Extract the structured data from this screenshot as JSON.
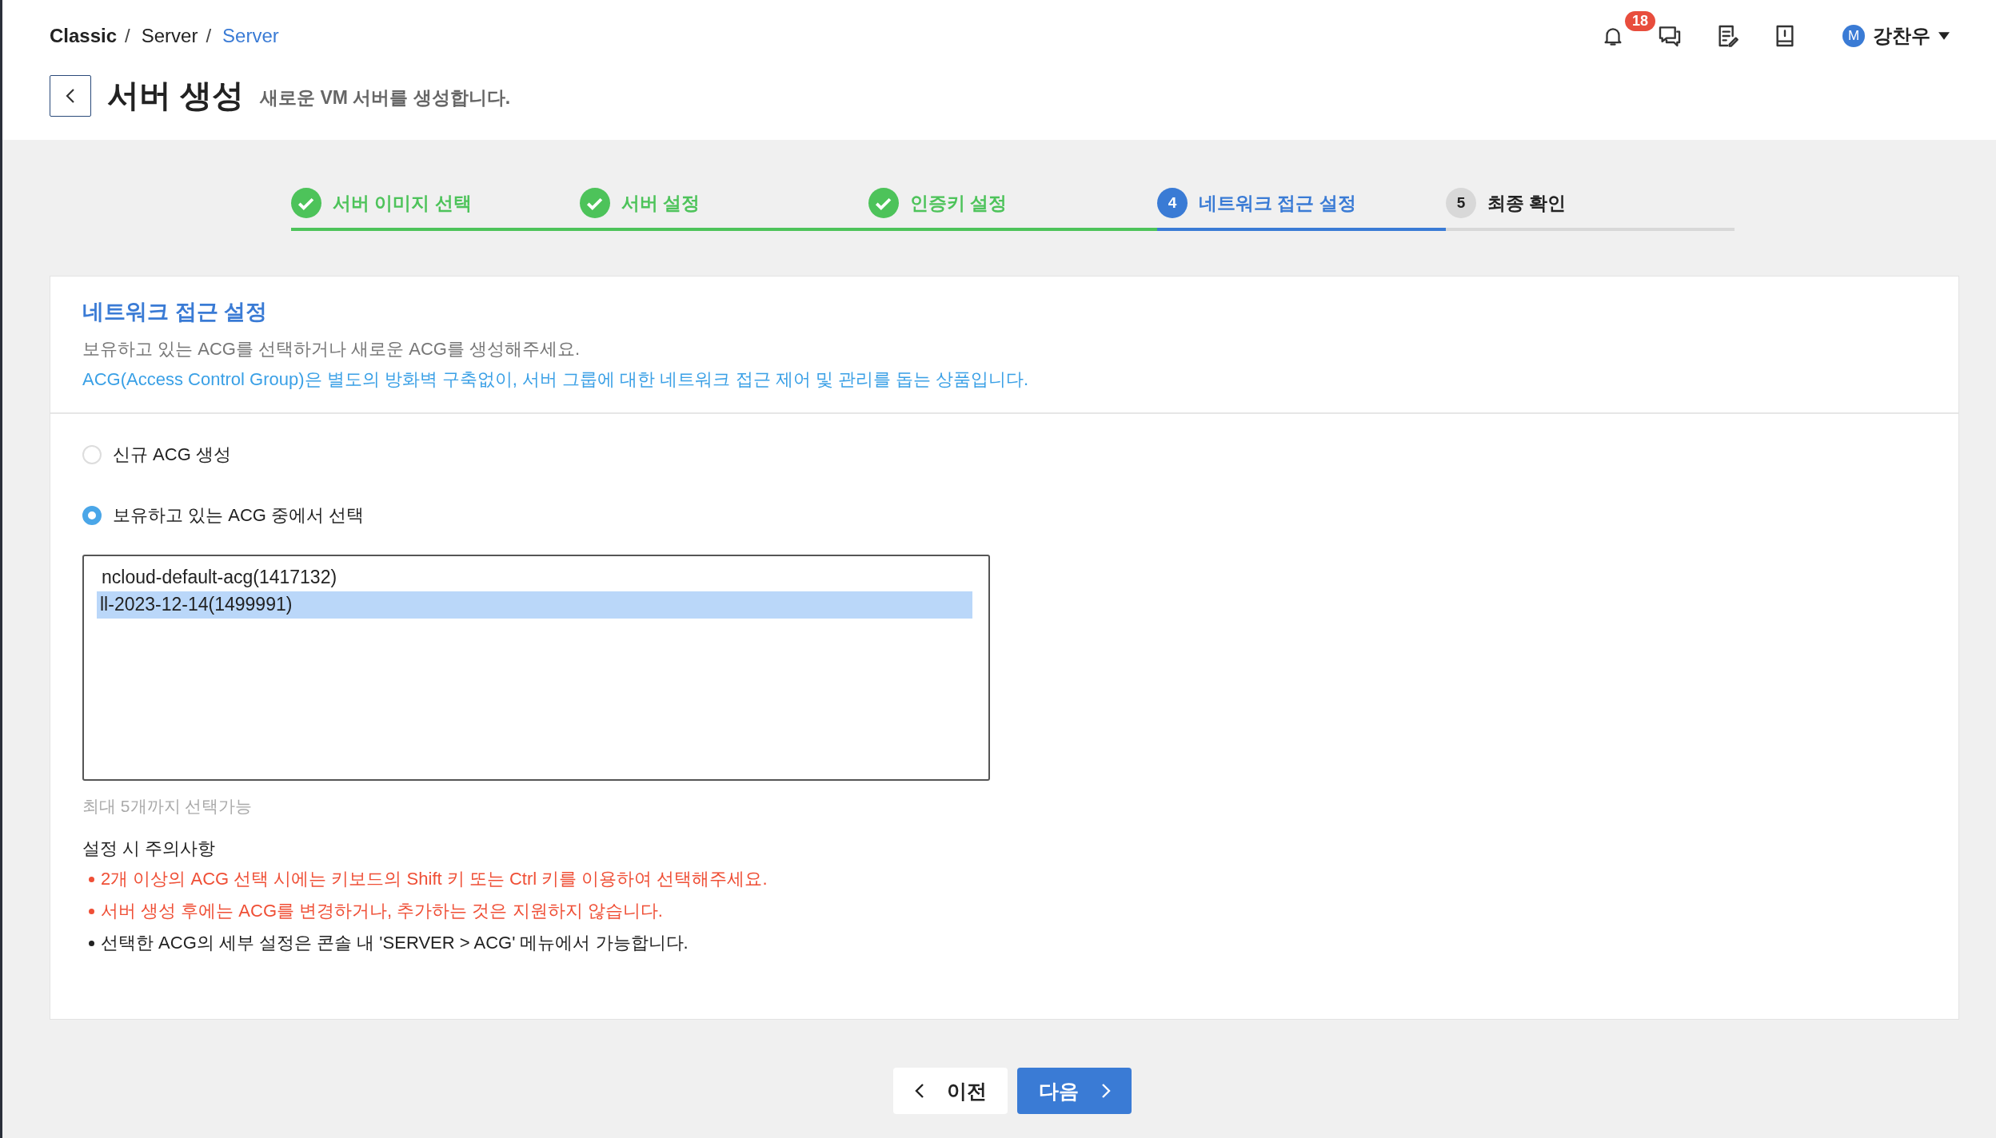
{
  "breadcrumb": [
    {
      "label": "Classic",
      "separator": "/",
      "current": false,
      "bold": true
    },
    {
      "label": "Server",
      "separator": "/",
      "current": false,
      "bold": false
    },
    {
      "label": "Server",
      "current": true,
      "bold": false
    }
  ],
  "header": {
    "title": "서버 생성",
    "subtitle": "새로운 VM 서버를 생성합니다.",
    "notification_count": "18",
    "user": {
      "initial": "M",
      "name": "강찬우"
    }
  },
  "steps": [
    {
      "label": "서버 이미지 선택",
      "done": true,
      "selected": false
    },
    {
      "label": "서버 설정",
      "done": true,
      "selected": false
    },
    {
      "label": "인증키 설정",
      "done": true,
      "selected": false
    },
    {
      "number": "4",
      "label": "네트워크 접근 설정",
      "done": false,
      "selected": true
    },
    {
      "number": "5",
      "label": "최종 확인",
      "done": false,
      "selected": false
    }
  ],
  "section": {
    "title": "네트워크 접근 설정",
    "description": "보유하고 있는 ACG를 선택하거나 새로운 ACG를 생성해주세요.",
    "info": "ACG(Access Control Group)은 별도의 방화벽 구축없이, 서버 그룹에 대한 네트워크 접근 제어 및 관리를 돕는 상품입니다."
  },
  "options": [
    {
      "label": "신규 ACG 생성",
      "selected": false
    },
    {
      "label": "보유하고 있는 ACG 중에서 선택",
      "selected": true
    }
  ],
  "acg_list": [
    {
      "label": "ncloud-default-acg(1417132)",
      "selected": false
    },
    {
      "label": "ll-2023-12-14(1499991)",
      "selected": true
    }
  ],
  "hint": "최대 5개까지 선택가능",
  "caution": {
    "title": "설정 시 주의사항",
    "items": [
      {
        "text": "2개 이상의 ACG 선택 시에는 키보드의 Shift 키 또는 Ctrl 키를 이용하여 선택해주세요.",
        "kind": "warning"
      },
      {
        "text": "서버 생성 후에는 ACG를 변경하거나, 추가하는 것은 지원하지 않습니다.",
        "kind": "warning"
      },
      {
        "text": "선택한 ACG의 세부 설정은 콘솔 내 'SERVER > ACG' 메뉴에서 가능합니다.",
        "kind": "info"
      }
    ]
  },
  "buttons": [
    {
      "label": "이전",
      "kind": "prev"
    },
    {
      "label": "다음",
      "kind": "next"
    }
  ]
}
